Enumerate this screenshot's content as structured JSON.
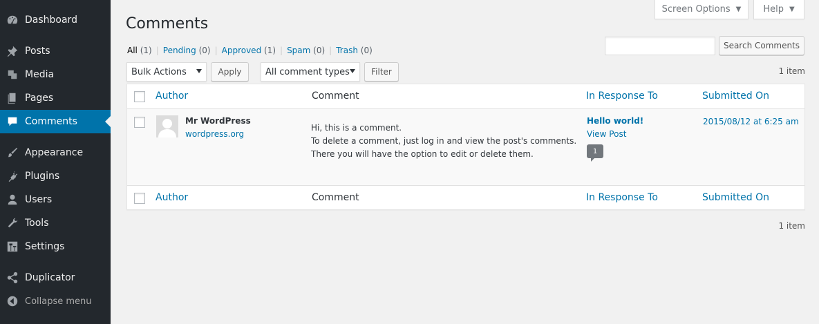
{
  "sidebar": {
    "items": [
      {
        "label": "Dashboard",
        "icon": "dashboard-icon"
      },
      {
        "label": "Posts",
        "icon": "pin-icon"
      },
      {
        "label": "Media",
        "icon": "media-icon"
      },
      {
        "label": "Pages",
        "icon": "pages-icon"
      },
      {
        "label": "Comments",
        "icon": "comment-icon"
      },
      {
        "label": "Appearance",
        "icon": "brush-icon"
      },
      {
        "label": "Plugins",
        "icon": "plugin-icon"
      },
      {
        "label": "Users",
        "icon": "user-icon"
      },
      {
        "label": "Tools",
        "icon": "wrench-icon"
      },
      {
        "label": "Settings",
        "icon": "settings-icon"
      },
      {
        "label": "Duplicator",
        "icon": "share-icon"
      },
      {
        "label": "Collapse menu",
        "icon": "collapse-icon"
      }
    ],
    "active": "Comments"
  },
  "header": {
    "screen_options": "Screen Options",
    "help": "Help",
    "title": "Comments"
  },
  "filters": {
    "all": {
      "label": "All",
      "count": "(1)"
    },
    "pending": {
      "label": "Pending",
      "count": "(0)"
    },
    "approved": {
      "label": "Approved",
      "count": "(1)"
    },
    "spam": {
      "label": "Spam",
      "count": "(0)"
    },
    "trash": {
      "label": "Trash",
      "count": "(0)"
    },
    "separator": "|"
  },
  "search": {
    "button": "Search Comments",
    "value": ""
  },
  "actions": {
    "bulk_select": "Bulk Actions",
    "apply": "Apply",
    "type_select": "All comment types",
    "filter": "Filter",
    "items_top": "1 item",
    "items_bottom": "1 item"
  },
  "table": {
    "columns": {
      "author": "Author",
      "comment": "Comment",
      "response": "In Response To",
      "submitted": "Submitted On"
    },
    "rows": [
      {
        "author_name": "Mr WordPress",
        "author_url": "wordpress.org",
        "comment_lines": [
          "Hi, this is a comment.",
          "To delete a comment, just log in and view the post's comments.",
          "There you will have the option to edit or delete them."
        ],
        "response_title": "Hello world!",
        "response_view": "View Post",
        "comment_count": "1",
        "submitted": "2015/08/12 at 6:25 am"
      }
    ]
  },
  "colors": {
    "sidebar": "#23282d",
    "active": "#0073aa",
    "link": "#0073aa",
    "background": "#f1f1f1"
  }
}
